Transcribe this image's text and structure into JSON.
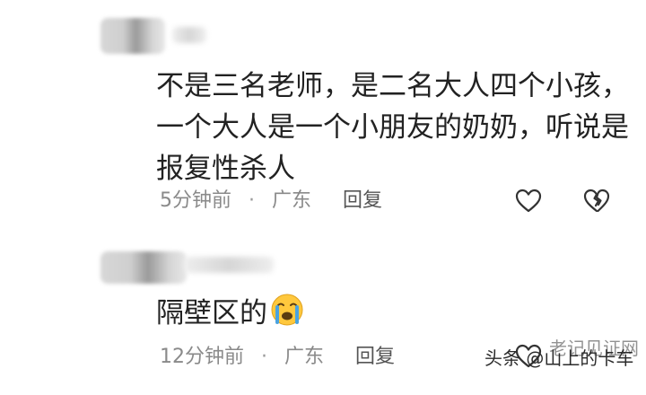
{
  "comments": [
    {
      "author": "",
      "text_lines": [
        "不是三名老师，是二名大人四个小孩，",
        "一个大人是一个小朋友的奶奶，听说是",
        "报复性杀人"
      ],
      "time": "5分钟前",
      "separator": "·",
      "location": "广东",
      "reply_label": "回复",
      "icons": [
        "heart-outline-icon",
        "broken-heart-outline-icon"
      ]
    },
    {
      "author": "",
      "text": "隔壁区的",
      "emoji": "crying-face-emoji",
      "time": "12分钟前",
      "separator": "·",
      "location": "广东",
      "reply_label": "回复",
      "icons": [
        "heart-outline-icon"
      ]
    }
  ],
  "watermark": {
    "main": "头条 @山上的卡车",
    "overlay": "老记见证网"
  },
  "colors": {
    "text": "#222222",
    "meta": "#8a8a8a",
    "icon": "#333333",
    "emoji_face": "#ffc83d",
    "emoji_tears": "#4aa3e0"
  }
}
